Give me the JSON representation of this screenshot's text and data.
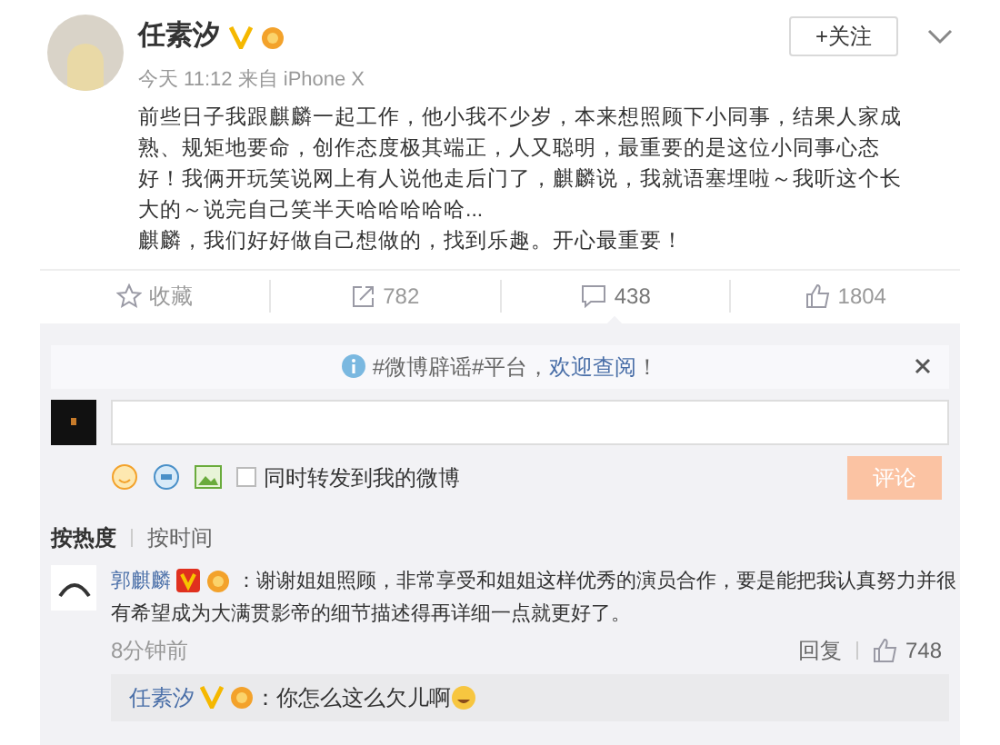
{
  "post": {
    "author": "任素汐",
    "follow_button": "+关注",
    "meta": "今天 11:12 来自 iPhone X",
    "paragraphs": [
      "前些日子我跟麒麟一起工作，他小我不少岁，本来想照顾下小同事，结果人家成熟、规矩地要命，创作态度极其端正，人又聪明，最重要的是这位小同事心态好！我俩开玩笑说网上有人说他走后门了，麒麟说，我就语塞埋啦～我听这个长大的～说完自己笑半天哈哈哈哈哈...",
      "麒麟，我们好好做自己想做的，找到乐趣。开心最重要！"
    ]
  },
  "actions": [
    {
      "kind": "favorite",
      "label": "收藏",
      "selected": false
    },
    {
      "kind": "repost",
      "label": "782",
      "selected": false
    },
    {
      "kind": "comment",
      "label": "438",
      "selected": true
    },
    {
      "kind": "like",
      "label": "1804",
      "selected": false
    }
  ],
  "notice": {
    "prefix": "#微博辟谣#平台，",
    "link": "欢迎查阅",
    "suffix": "！"
  },
  "composer": {
    "repost_checkbox": {
      "label": "同时转发到我的微博",
      "checked": false
    },
    "submit": "评论",
    "disabled": true
  },
  "sort_tabs": [
    {
      "label": "按热度",
      "selected": true
    },
    {
      "label": "按时间",
      "selected": false
    }
  ],
  "comments": [
    {
      "author": "郭麒麟",
      "text_lines": [
        "：谢谢姐姐照顾，非常享受和姐姐这样优秀的演员合作，要是能把我认真努力并很",
        "有希望成为大满贯影帝的细节描述得再详细一点就更好了。"
      ],
      "time": "8分钟前",
      "reply": "回复",
      "likes": "748",
      "replies": [
        {
          "author": "任素汐",
          "text": "：你怎么这么欠儿啊"
        }
      ]
    }
  ]
}
